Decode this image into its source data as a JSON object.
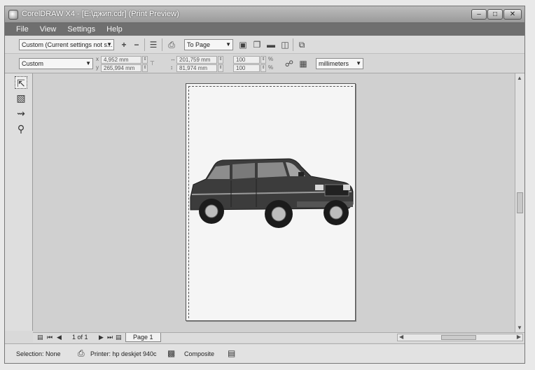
{
  "window": {
    "title": "CorelDRAW X4 - [E:\\джип.cdr] (Print Preview)",
    "controls": [
      "minimize",
      "maximize",
      "close"
    ]
  },
  "menu": [
    "File",
    "View",
    "Settings",
    "Help"
  ],
  "toolbar1": {
    "print_style": "Custom (Current settings not s...",
    "fit_option": "To Page",
    "icons": [
      "add-icon",
      "remove-icon",
      "print-options-icon",
      "print-icon",
      "zoom-icon",
      "layout-icon",
      "preview-icon",
      "close-preview-icon"
    ]
  },
  "toolbar2": {
    "preset": "Custom",
    "position_x": "4,952 mm",
    "position_y": "265,994 mm",
    "size_w": "201,759 mm",
    "size_h": "81,974 mm",
    "scale_x": "100",
    "scale_y": "100",
    "units": "millimeters"
  },
  "tools": [
    "pick-tool-icon",
    "imposition-layout-tool-icon",
    "marks-placement-tool-icon",
    "zoom-tool-icon"
  ],
  "navigation": {
    "page_count": "1 of 1",
    "page_tab": "Page 1"
  },
  "status": {
    "selection": "Selection: None",
    "printer": "Printer: hp deskjet 940c",
    "mode": "Composite"
  }
}
